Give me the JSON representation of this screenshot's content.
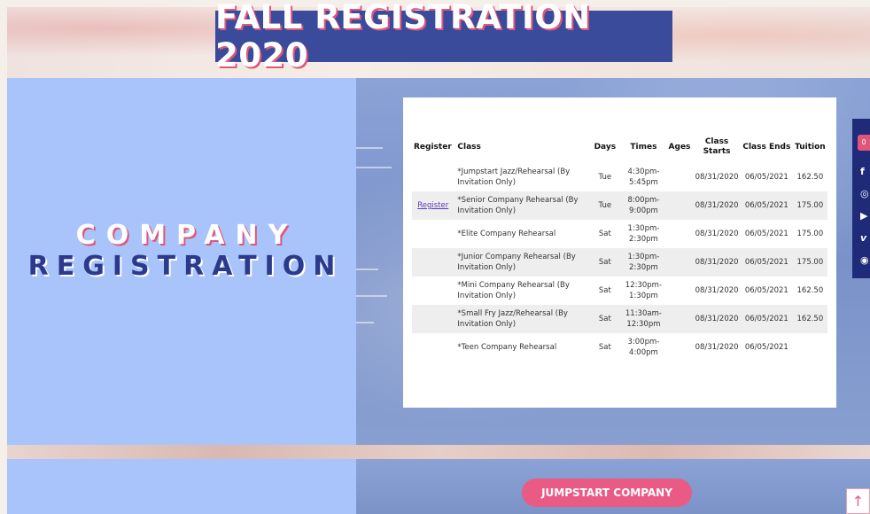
{
  "banner": {
    "title": "FALL REGISTRATION 2020"
  },
  "section": {
    "title_line1": "COMPANY",
    "title_line2": "REGISTRATION"
  },
  "table": {
    "headers": [
      "Register",
      "Class",
      "Days",
      "Times",
      "Ages",
      "Class Starts",
      "Class Ends",
      "Tuition"
    ],
    "rows": [
      {
        "register": "",
        "class": "*Jumpstart Jazz/Rehearsal (By Invitation Only)",
        "days": "Tue",
        "times": "4:30pm-5:45pm",
        "ages": "",
        "starts": "08/31/2020",
        "ends": "06/05/2021",
        "tuition": "162.50"
      },
      {
        "register": "Register",
        "class": "*Senior Company Rehearsal (By Invitation Only)",
        "days": "Tue",
        "times": "8:00pm-9:00pm",
        "ages": "",
        "starts": "08/31/2020",
        "ends": "06/05/2021",
        "tuition": "175.00"
      },
      {
        "register": "",
        "class": "*Elite Company Rehearsal",
        "days": "Sat",
        "times": "1:30pm-2:30pm",
        "ages": "",
        "starts": "08/31/2020",
        "ends": "06/05/2021",
        "tuition": "175.00"
      },
      {
        "register": "",
        "class": "*Junior Company Rehearsal (By Invitation Only)",
        "days": "Sat",
        "times": "1:30pm-2:30pm",
        "ages": "",
        "starts": "08/31/2020",
        "ends": "06/05/2021",
        "tuition": "175.00"
      },
      {
        "register": "",
        "class": "*Mini Company Rehearsal (By Invitation Only)",
        "days": "Sat",
        "times": "12:30pm-1:30pm",
        "ages": "",
        "starts": "08/31/2020",
        "ends": "06/05/2021",
        "tuition": "162.50"
      },
      {
        "register": "",
        "class": "*Small Fry Jazz/Rehearsal (By Invitation Only)",
        "days": "Sat",
        "times": "11:30am-12:30pm",
        "ages": "",
        "starts": "08/31/2020",
        "ends": "06/05/2021",
        "tuition": "162.50"
      },
      {
        "register": "",
        "class": "*Teen Company Rehearsal",
        "days": "Sat",
        "times": "3:00pm-4:00pm",
        "ages": "",
        "starts": "08/31/2020",
        "ends": "06/05/2021",
        "tuition": ""
      }
    ]
  },
  "social": {
    "cart_count": "0",
    "icons": [
      "facebook-icon",
      "instagram-icon",
      "youtube-icon",
      "vimeo-icon",
      "rss-icon"
    ]
  },
  "cta": {
    "label": "JUMPSTART COMPANY"
  },
  "colors": {
    "title_bg": "#3b4b9b",
    "accent_pink": "#e95b84",
    "panel_blue": "#a8c4fb",
    "sidebar_navy": "#1f2a78"
  }
}
